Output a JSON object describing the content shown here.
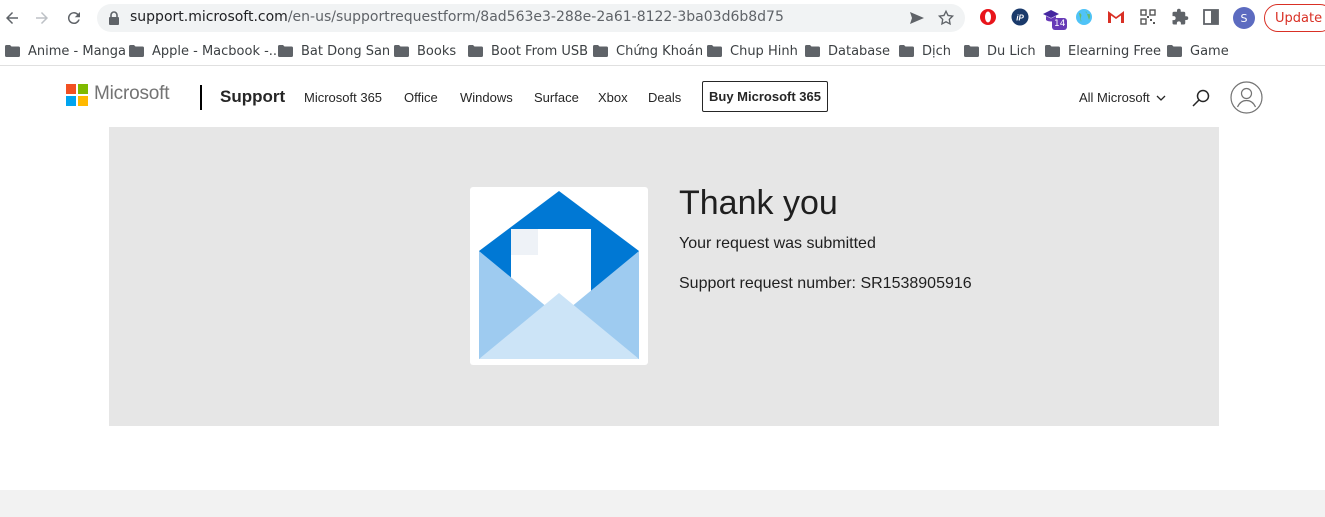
{
  "browser": {
    "url_host": "support.microsoft.com",
    "url_path": "/en-us/supportrequestform/8ad563e3-288e-2a61-8122-3ba03d6b8d75",
    "extension_badge": "14",
    "profile_initial": "S",
    "update_label": "Update",
    "icons": [
      "back-icon",
      "forward-icon",
      "reload-icon",
      "lock-icon",
      "send-icon",
      "star-icon",
      "opera-icon",
      "ip-icon",
      "graduation-icon",
      "globe-icon",
      "gmail-icon",
      "qr-icon",
      "puzzle-icon",
      "sidepanel-icon"
    ]
  },
  "bookmarks": [
    {
      "label": "Anime - Manga"
    },
    {
      "label": "Apple - Macbook -..."
    },
    {
      "label": "Bat Dong San"
    },
    {
      "label": "Books"
    },
    {
      "label": "Boot From USB"
    },
    {
      "label": "Chứng Khoán"
    },
    {
      "label": "Chup Hinh"
    },
    {
      "label": "Database"
    },
    {
      "label": "Dịch"
    },
    {
      "label": "Du Lich"
    },
    {
      "label": "Elearning Free"
    },
    {
      "label": "Game"
    }
  ],
  "header": {
    "brand": "Microsoft",
    "section": "Support",
    "nav": [
      "Microsoft 365",
      "Office",
      "Windows",
      "Surface",
      "Xbox",
      "Deals"
    ],
    "buy_label": "Buy Microsoft 365",
    "all_microsoft": "All Microsoft",
    "logo_colors": [
      "#f25022",
      "#7fba00",
      "#00a4ef",
      "#ffb900"
    ]
  },
  "confirmation": {
    "title": "Thank you",
    "subtitle": "Your request was submitted",
    "request_label": "Support request number:",
    "request_number": "SR1538905916"
  },
  "colors": {
    "panel_bg": "#e6e6e6",
    "envelope_dark": "#0078d4",
    "envelope_mid": "#9ecbf0",
    "envelope_light": "#cce4f7"
  }
}
